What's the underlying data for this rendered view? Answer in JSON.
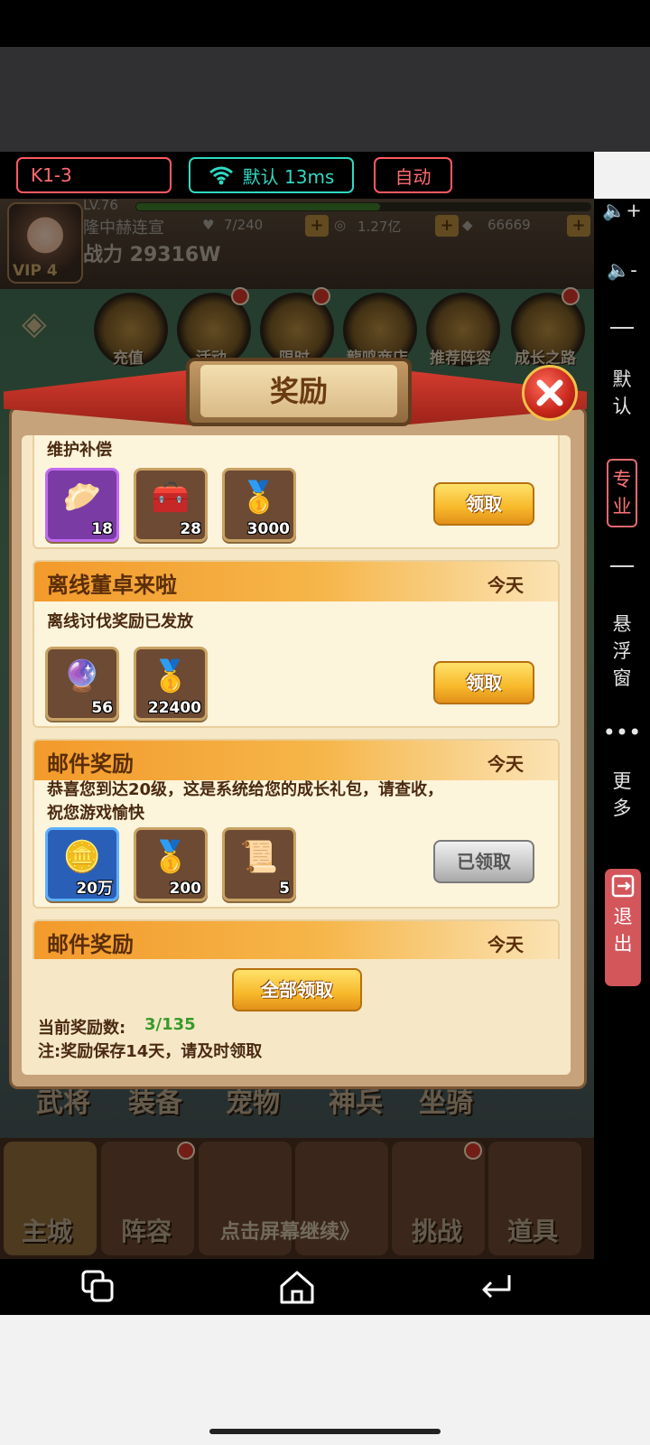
{
  "toolbar": {
    "level": "K1-3",
    "network": "默认 13ms",
    "auto": "自动"
  },
  "hud": {
    "level": "LV.76",
    "name": "隆中赫连宣",
    "power": "战力 29316W",
    "vip": "VIP 4",
    "stamina": "7/240",
    "coins": "1.27亿",
    "ingots": "66669"
  },
  "feature_rings": [
    "充值",
    "活动",
    "限时",
    "龍鸣商店",
    "推荐阵容",
    "成长之路"
  ],
  "bottom_labels": [
    "武将",
    "装备",
    "宠物",
    "神兵",
    "坐骑"
  ],
  "nav_tabs": [
    "主城",
    "阵容",
    "",
    "",
    "挑战",
    "道具"
  ],
  "continue_hint": "点击屏幕继续》",
  "dialog": {
    "title": "奖励",
    "mails": [
      {
        "title": "",
        "date": "",
        "desc": "维护补偿",
        "items": [
          {
            "icon": "steamed-bun-icon",
            "qty": "18",
            "rarity": "purple"
          },
          {
            "icon": "treasure-chest-icon",
            "qty": "28",
            "rarity": "normal"
          },
          {
            "icon": "gold-ingot-icon",
            "qty": "3000",
            "rarity": "normal"
          }
        ],
        "button": "领取",
        "claimed": false
      },
      {
        "title": "离线董卓来啦",
        "date": "今天",
        "desc": "离线讨伐奖励已发放",
        "items": [
          {
            "icon": "purple-orb-icon",
            "qty": "56",
            "rarity": "normal"
          },
          {
            "icon": "gold-ingot-icon",
            "qty": "22400",
            "rarity": "normal"
          }
        ],
        "button": "领取",
        "claimed": false
      },
      {
        "title": "邮件奖励",
        "date": "今天",
        "desc": "恭喜您到达20级，这是系统给您的成长礼包，请查收，\n祝您游戏愉快",
        "items": [
          {
            "icon": "copper-coin-icon",
            "qty": "20万",
            "rarity": "blue"
          },
          {
            "icon": "gold-ingot-icon",
            "qty": "200",
            "rarity": "normal"
          },
          {
            "icon": "scroll-map-icon",
            "qty": "5",
            "rarity": "normal"
          }
        ],
        "button": "已领取",
        "claimed": true
      },
      {
        "title": "邮件奖励",
        "date": "今天"
      }
    ],
    "claim_all": "全部领取",
    "count_label": "当前奖励数:",
    "count_value": "3/135",
    "note": "注:奖励保存14天，请及时领取"
  },
  "side_panel": {
    "vol_up": "🔈+",
    "vol_down": "🔈-",
    "default_label": "默认",
    "pro_label": "专业",
    "float_label": "悬浮窗",
    "more_label": "更多",
    "exit_label": "退出"
  },
  "colors": {
    "accent_red": "#ff5a5f",
    "accent_teal": "#2fd9c1",
    "count_green": "#3a9a2a"
  }
}
